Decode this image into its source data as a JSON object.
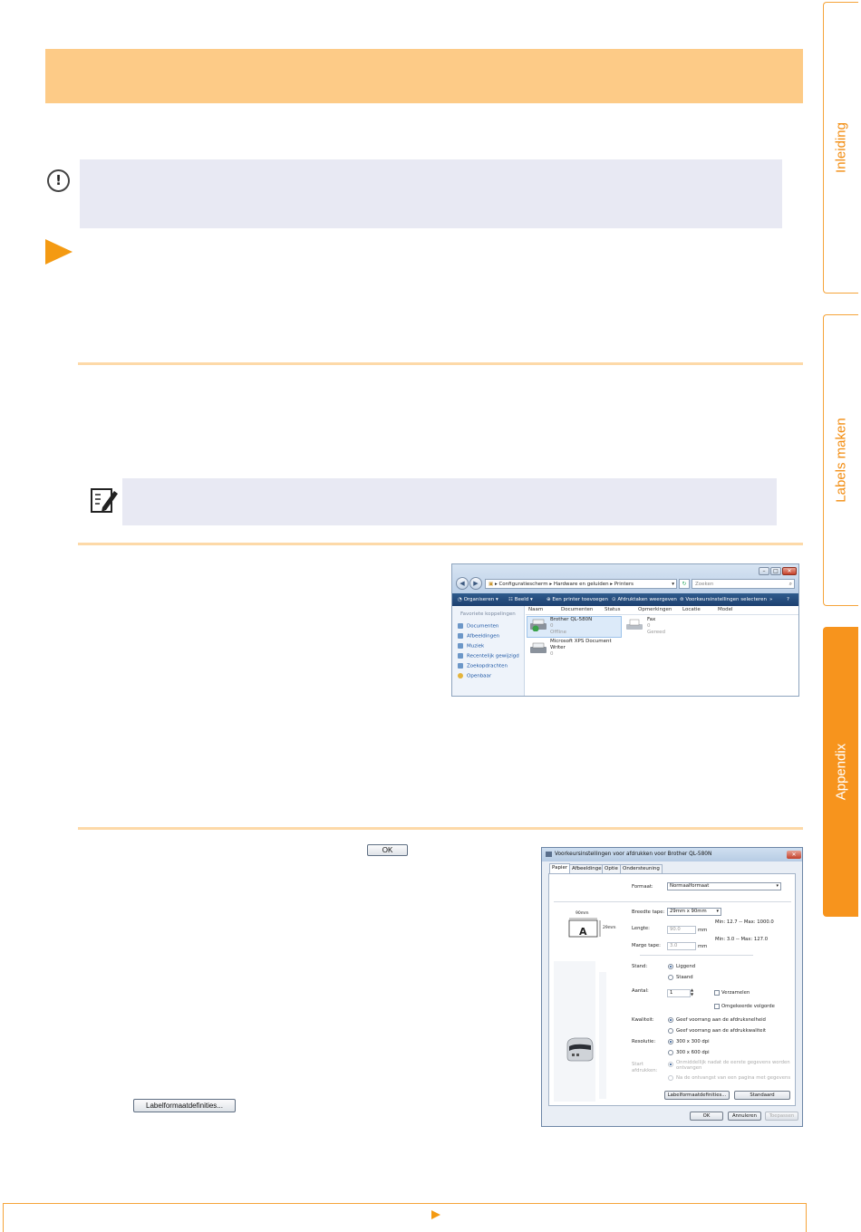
{
  "side_tabs": [
    {
      "label": "Inleiding",
      "active": false
    },
    {
      "label": "Labels maken",
      "active": false
    },
    {
      "label": "Appendix",
      "active": true
    }
  ],
  "inline_buttons": {
    "ok": "OK",
    "label_format": "Labelformaatdefinities..."
  },
  "explorer": {
    "address": [
      "Configuratiescherm",
      "Hardware en geluiden",
      "Printers"
    ],
    "search_placeholder": "Zoeken",
    "toolbar": [
      "Organiseren",
      "Beeld",
      "Een printer toevoegen",
      "Afdruktaken weergeven",
      "Voorkeursinstellingen selecteren"
    ],
    "sidebar_title": "Favoriete koppelingen",
    "sidebar_items": [
      "Documenten",
      "Afbeeldingen",
      "Muziek",
      "Recentelijk gewijzigd",
      "Zoekopdrachten",
      "Openbaar"
    ],
    "columns": [
      "Naam",
      "Documenten",
      "Status",
      "Opmerkingen",
      "Locatie",
      "Model"
    ],
    "items": [
      {
        "name": "Brother QL-580N",
        "count": "0",
        "status": "Offline"
      },
      {
        "name": "Fax",
        "count": "0",
        "status": "Gereed"
      },
      {
        "name": "Microsoft XPS Document Writer",
        "line1": "Microsoft XPS Document",
        "line2": "Writer",
        "count": "0"
      }
    ]
  },
  "dialog": {
    "title": "Voorkeursinstellingen voor afdrukken voor Brother QL-580N",
    "tabs": [
      "Papier",
      "Afbeeldingen",
      "Optie",
      "Ondersteuning"
    ],
    "format_label": "Formaat:",
    "format_value": "Normaalformaat",
    "tape_width_label": "Breedte tape:",
    "tape_width_value": "29mm x 90mm",
    "length_label": "Lengte:",
    "length_value": "90.0",
    "length_unit": "mm",
    "length_range": "Min: 12.7 -- Max: 1000.0",
    "margin_label": "Marge tape:",
    "margin_value": "3.0",
    "margin_unit": "mm",
    "margin_range": "Min: 3.0 -- Max: 127.0",
    "preview_width": "90mm",
    "preview_letter": "A",
    "preview_height": "29mm",
    "orientation_label": "Stand:",
    "orientation_options": [
      "Liggend",
      "Staand"
    ],
    "copies_label": "Aantal:",
    "copies_value": "1",
    "collate": "Verzamelen",
    "reverse": "Omgekeerde volgorde",
    "quality_label": "Kwaliteit:",
    "quality_options": [
      "Geef voorrang aan de afdruksnelheid",
      "Geef voorrang aan de afdrukkwaliteit"
    ],
    "resolution_label": "Resolutie:",
    "resolution_options": [
      "300 x 300 dpi",
      "300 x 600 dpi"
    ],
    "start_label_1": "Start",
    "start_label_2": "afdrukken:",
    "start_options": [
      "Onmiddellijk nadat de eerste gegevens worden ontvangen",
      "Na de ontvangst van een pagina met gegevens"
    ],
    "start_option1_line1": "Onmiddellijk nadat de eerste gegevens worden",
    "start_option1_line2": "ontvangen",
    "btn_label_format": "Labelformaatdefinities...",
    "btn_standard": "Standaard",
    "btn_ok": "OK",
    "btn_cancel": "Annuleren",
    "btn_apply": "Toepassen"
  }
}
